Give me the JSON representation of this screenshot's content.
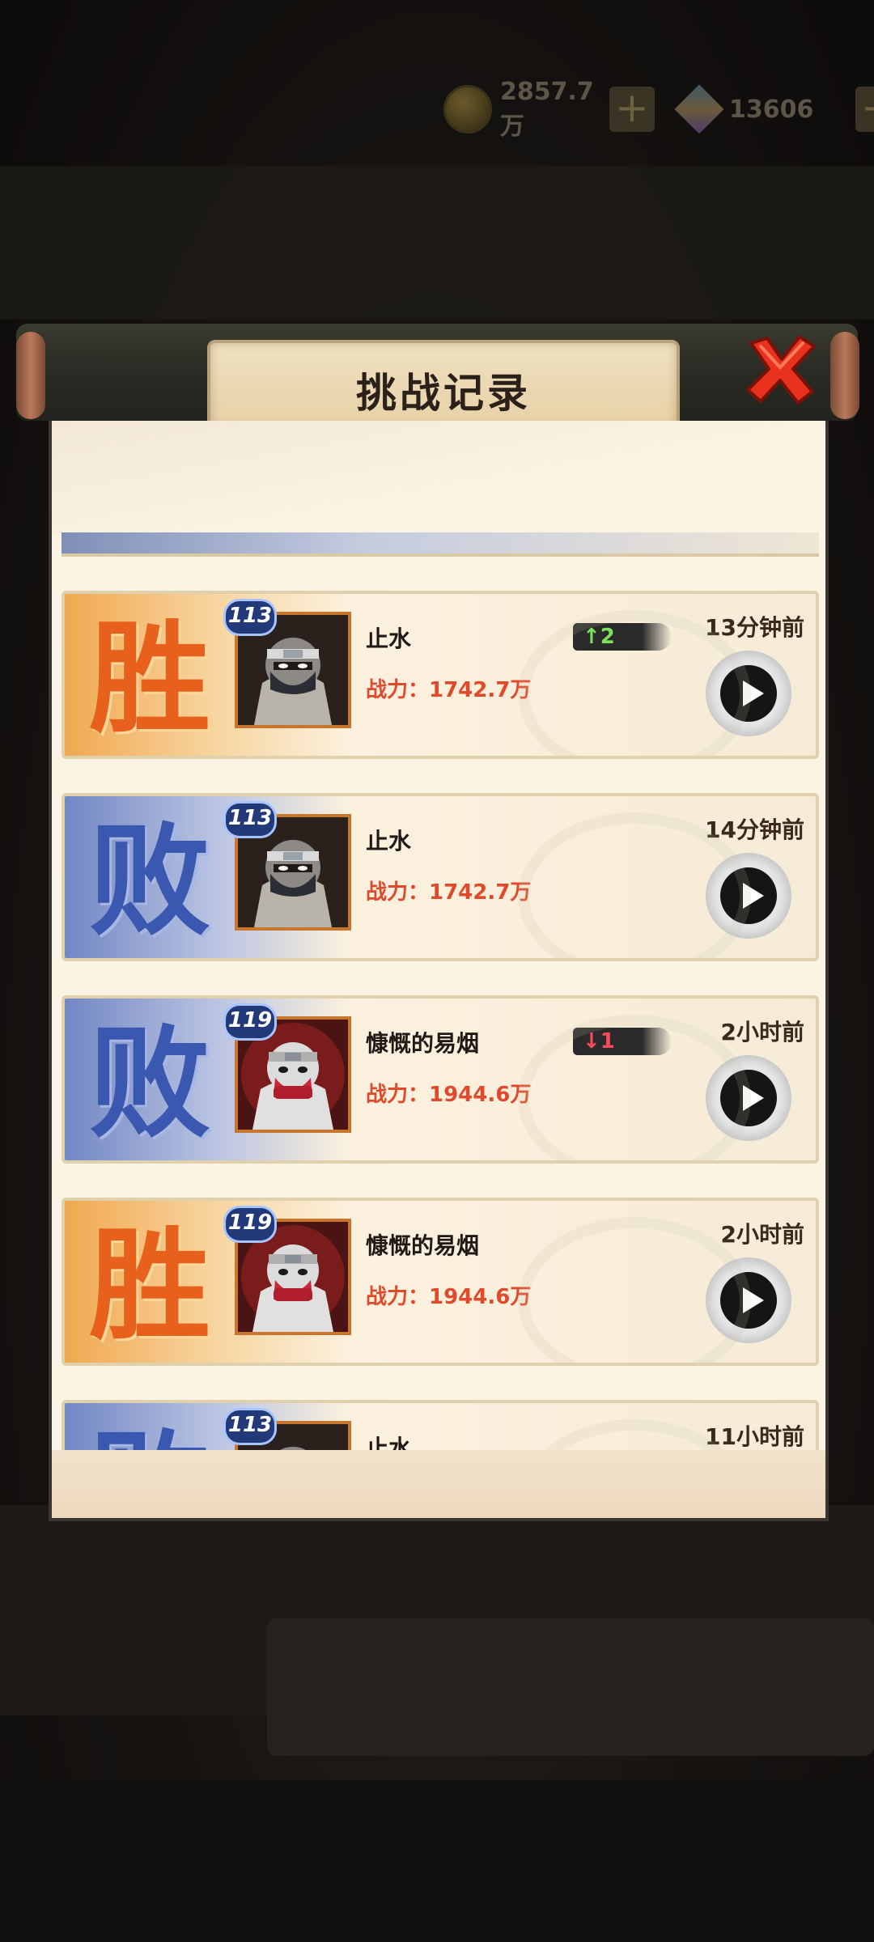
{
  "resources": {
    "coins": "2857.7万",
    "gems": "13606"
  },
  "dialog": {
    "title": "挑战记录"
  },
  "records": [
    {
      "result": "胜",
      "outcome": "win",
      "level": "113",
      "name": "止水",
      "power": "战力：1742.7万",
      "rank_change": "↑2",
      "rank_dir": "up",
      "time": "13分钟前",
      "avatar": "masked-ninja-grey"
    },
    {
      "result": "败",
      "outcome": "lose",
      "level": "113",
      "name": "止水",
      "power": "战力：1742.7万",
      "rank_change": "",
      "rank_dir": "",
      "time": "14分钟前",
      "avatar": "masked-ninja-grey"
    },
    {
      "result": "败",
      "outcome": "lose",
      "level": "119",
      "name": "慷慨的易烟",
      "power": "战力：1944.6万",
      "rank_change": "↓1",
      "rank_dir": "down",
      "time": "2小时前",
      "avatar": "masked-ninja-red"
    },
    {
      "result": "胜",
      "outcome": "win",
      "level": "119",
      "name": "慷慨的易烟",
      "power": "战力：1944.6万",
      "rank_change": "",
      "rank_dir": "",
      "time": "2小时前",
      "avatar": "masked-ninja-red"
    },
    {
      "result": "败",
      "outcome": "lose",
      "level": "113",
      "name": "止水",
      "power": "",
      "rank_change": "",
      "rank_dir": "",
      "time": "11小时前",
      "avatar": "masked-ninja-grey"
    }
  ],
  "icons": {
    "close": "close-x-icon",
    "play": "play-icon",
    "coin": "coin-icon",
    "gem": "gem-icon",
    "plus": "plus-icon"
  },
  "colors": {
    "win": "#e8611c",
    "lose": "#3b58b0",
    "power": "#e04a2c",
    "rank_up": "#7be25a",
    "rank_down": "#ff4a5a"
  }
}
